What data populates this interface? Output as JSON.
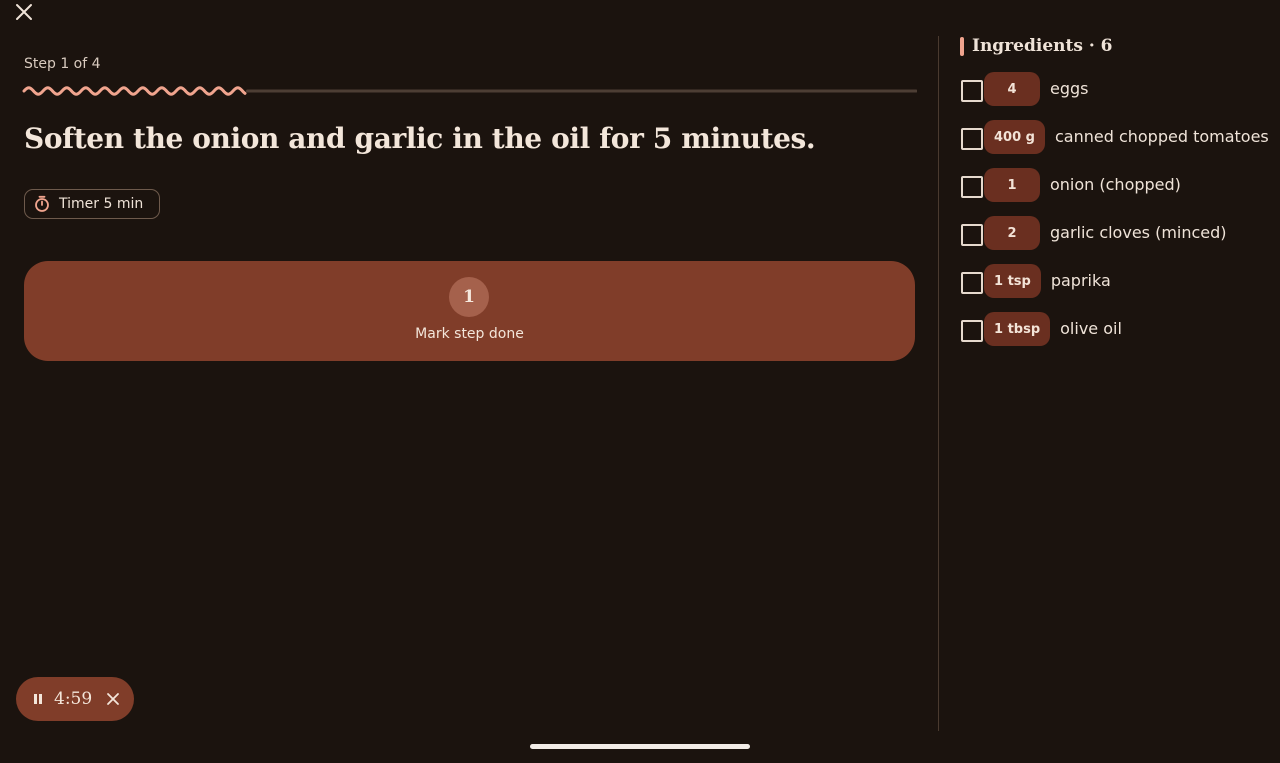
{
  "window": {
    "close_icon": "close-icon"
  },
  "step": {
    "label": "Step 1 of 4",
    "current": 1,
    "total": 4,
    "progress_fraction": 0.25,
    "instruction": "Soften the onion and garlic in the oil for 5 minutes.",
    "timer_chip_label": "Timer 5 min",
    "timer_icon": "stopwatch-icon",
    "done_number": "1",
    "done_label": "Mark step done"
  },
  "ingredients": {
    "title": "Ingredients · 6",
    "items": [
      {
        "qty": "4",
        "name": "eggs",
        "checked": false
      },
      {
        "qty": "400 g",
        "name": "canned chopped tomatoes",
        "checked": false
      },
      {
        "qty": "1",
        "name": "onion (chopped)",
        "checked": false
      },
      {
        "qty": "2",
        "name": "garlic cloves (minced)",
        "checked": false
      },
      {
        "qty": "1 tsp",
        "name": "paprika",
        "checked": false
      },
      {
        "qty": "1 tbsp",
        "name": "olive oil",
        "checked": false
      }
    ]
  },
  "running_timer": {
    "time": "4:59",
    "pause_icon": "pause-icon",
    "close_icon": "close-icon"
  },
  "colors": {
    "background": "#1b130e",
    "accent": "#803d29",
    "progress": "#f0a48e",
    "quantity_chip": "#6a2f20"
  }
}
